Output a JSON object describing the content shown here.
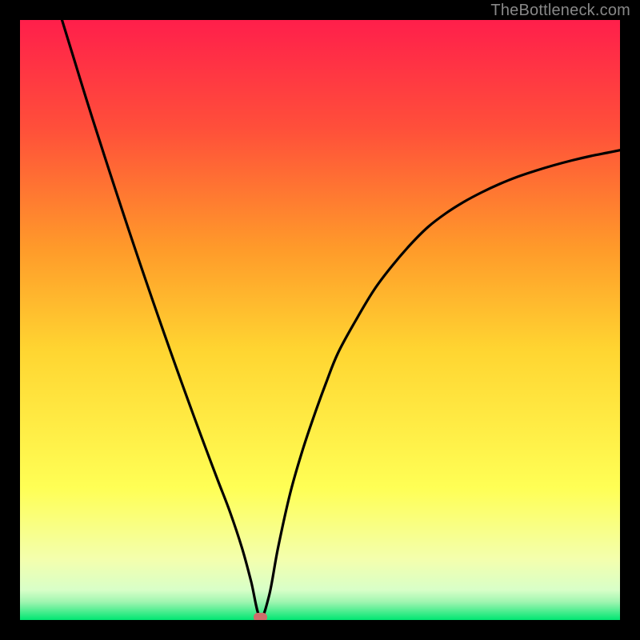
{
  "watermark": "TheBottleneck.com",
  "colors": {
    "gradient_top": "#ff1f4b",
    "gradient_mid_upper": "#ff8a2a",
    "gradient_mid": "#ffd531",
    "gradient_mid_lower": "#ffff6a",
    "gradient_low": "#f6ffc4",
    "gradient_bottom": "#00e672",
    "curve": "#000000",
    "marker": "#cc6f6b",
    "frame": "#000000"
  },
  "chart_data": {
    "type": "line",
    "title": "",
    "xlabel": "",
    "ylabel": "",
    "xlim": [
      0,
      100
    ],
    "ylim": [
      0,
      100
    ],
    "note": "Axes are unlabeled in the source image; x/y are normalized 0–100 across the plot area. y=0 corresponds to the green bottom (minimum bottleneck), y=100 to the red top.",
    "marker": {
      "x": 40.0,
      "y": 0.0
    },
    "series": [
      {
        "name": "curve",
        "x": [
          7.0,
          9.0,
          11.0,
          13.0,
          15.0,
          17.0,
          19.0,
          21.0,
          23.0,
          25.0,
          27.0,
          29.0,
          31.0,
          33.0,
          35.0,
          37.0,
          38.5,
          40.0,
          41.5,
          43.0,
          45.0,
          47.0,
          49.0,
          51.0,
          53.0,
          56.0,
          59.0,
          62.0,
          65.0,
          68.0,
          71.0,
          74.0,
          77.0,
          80.0,
          83.0,
          86.0,
          89.0,
          92.0,
          95.0,
          98.0,
          100.0
        ],
        "y": [
          100.0,
          93.5,
          87.0,
          80.7,
          74.5,
          68.4,
          62.4,
          56.5,
          50.7,
          45.0,
          39.4,
          33.9,
          28.5,
          23.2,
          18.0,
          12.0,
          6.5,
          0.5,
          4.0,
          12.0,
          21.0,
          28.0,
          34.0,
          39.5,
          44.5,
          50.0,
          55.0,
          59.0,
          62.5,
          65.5,
          67.8,
          69.7,
          71.3,
          72.7,
          73.9,
          74.9,
          75.8,
          76.6,
          77.3,
          77.9,
          78.3
        ]
      }
    ]
  }
}
